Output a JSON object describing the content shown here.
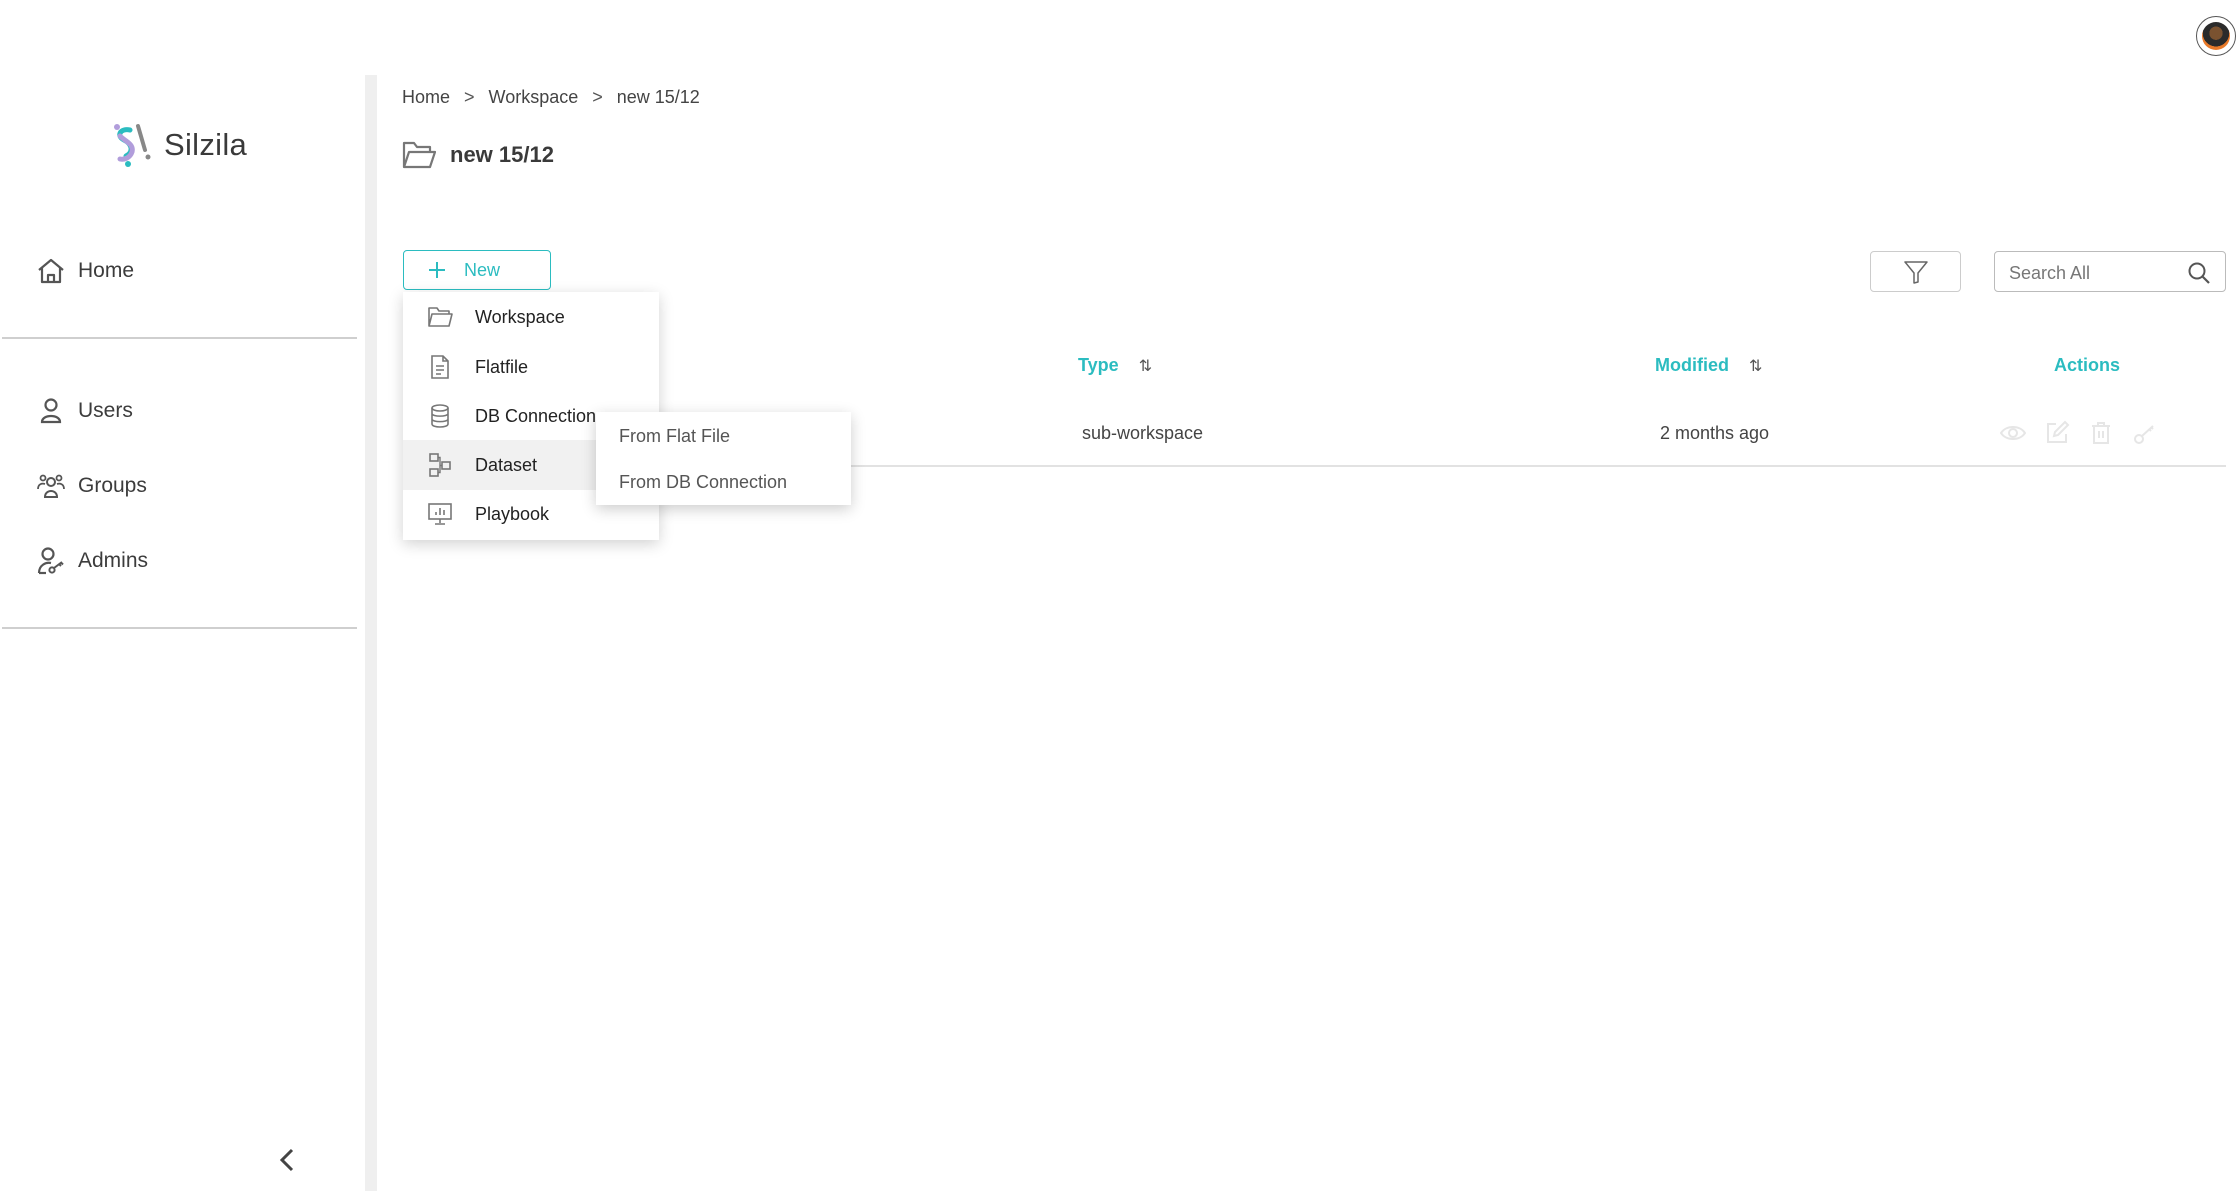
{
  "app": {
    "name": "Silzila"
  },
  "sidebar": {
    "items": [
      {
        "label": "Home",
        "icon": "home-icon"
      },
      {
        "label": "Users",
        "icon": "user-icon"
      },
      {
        "label": "Groups",
        "icon": "groups-icon"
      },
      {
        "label": "Admins",
        "icon": "admin-key-icon"
      }
    ],
    "collapse_icon": "chevron-left-icon"
  },
  "breadcrumb": {
    "items": [
      "Home",
      "Workspace",
      "new 15/12"
    ],
    "separator": ">"
  },
  "page": {
    "title": "new 15/12",
    "title_icon": "folder-open-icon"
  },
  "toolbar": {
    "new_label": "New",
    "filter_icon": "filter-icon",
    "search_placeholder": "Search All",
    "search_icon": "search-icon"
  },
  "new_menu": {
    "items": [
      {
        "label": "Workspace",
        "icon": "folder-icon"
      },
      {
        "label": "Flatfile",
        "icon": "file-icon"
      },
      {
        "label": "DB Connection",
        "icon": "database-icon"
      },
      {
        "label": "Dataset",
        "icon": "dataset-icon",
        "active": true
      },
      {
        "label": "Playbook",
        "icon": "playbook-icon"
      }
    ],
    "dataset_submenu": [
      "From Flat File",
      "From DB Connection"
    ]
  },
  "table": {
    "columns": [
      {
        "label": "Type",
        "sortable": true
      },
      {
        "label": "Modified",
        "sortable": true
      },
      {
        "label": "Actions",
        "sortable": false
      }
    ],
    "rows": [
      {
        "type": "sub-workspace",
        "modified": "2 months ago",
        "actions": [
          "view-icon",
          "edit-icon",
          "delete-icon",
          "key-icon"
        ]
      }
    ]
  },
  "colors": {
    "accent": "#2bbcc0",
    "text": "#333333",
    "divider": "#cfcfcf"
  }
}
